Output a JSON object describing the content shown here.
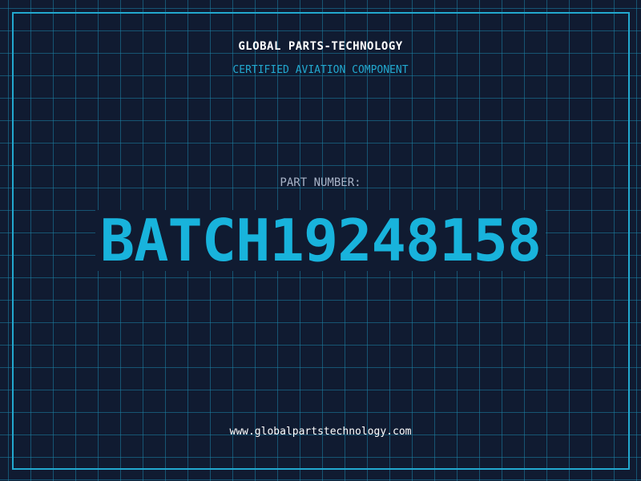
{
  "label": {
    "brand": "GLOBAL PARTS-TECHNOLOGY",
    "tagline": "CERTIFIED AVIATION COMPONENT",
    "part_number_label": "PART NUMBER:",
    "part_number": "BATCH19248158",
    "website": "www.globalpartstechnology.com"
  },
  "colors": {
    "background": "#101b31",
    "grid": "#1c84a8",
    "accent": "#22a8cf",
    "part_number": "#18b3dc",
    "text_white": "#ffffff",
    "text_muted": "#a8b3c7"
  }
}
